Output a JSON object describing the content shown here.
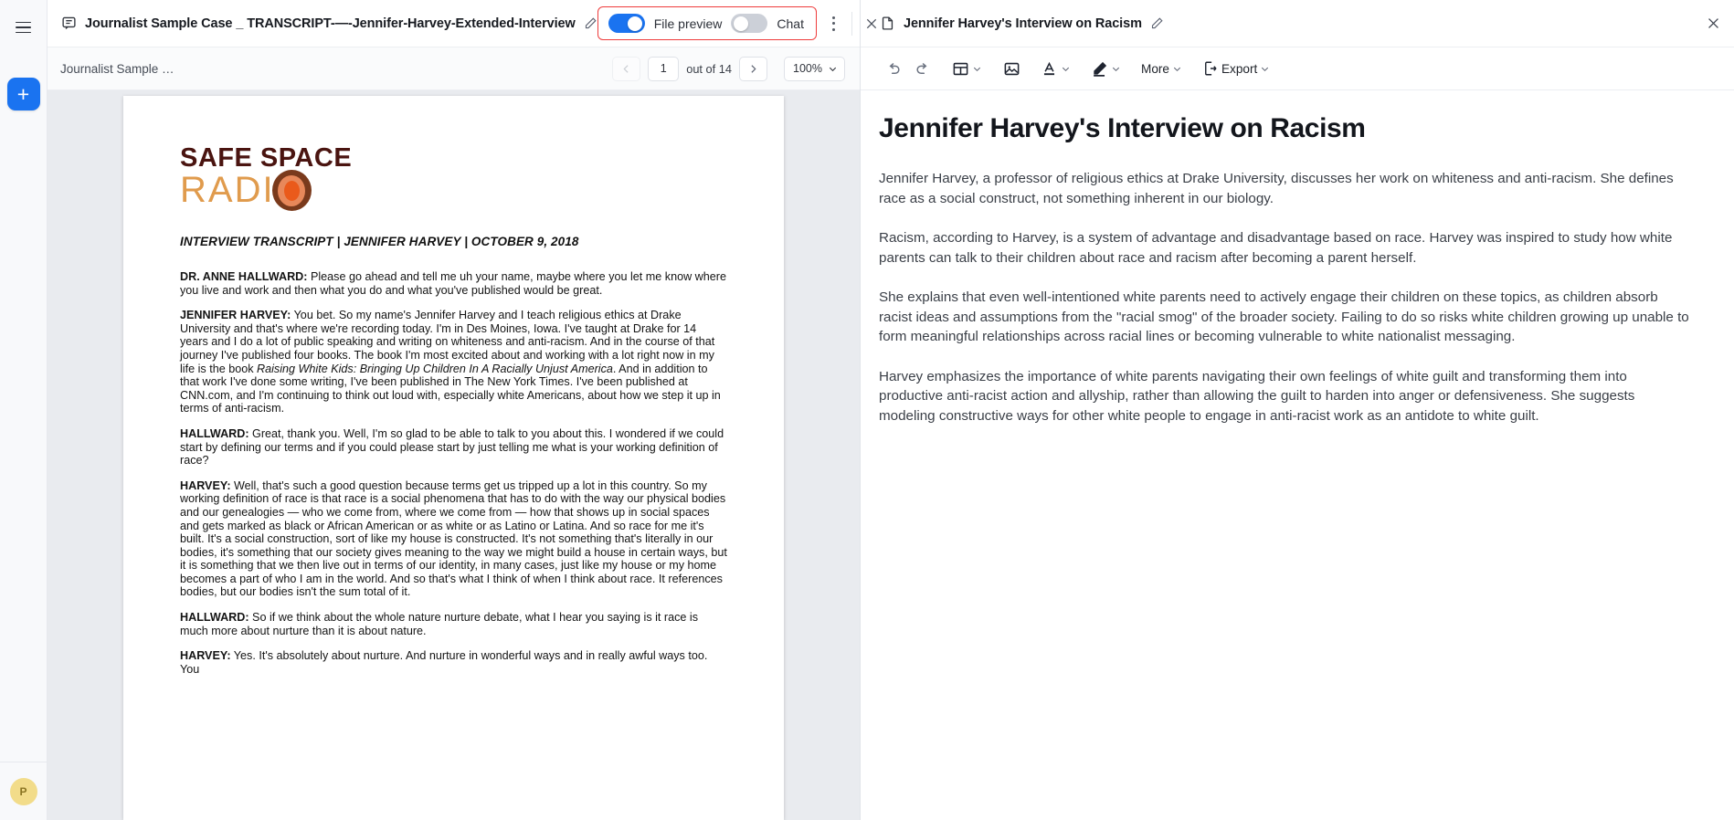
{
  "rail": {
    "menu_icon": "hamburger-icon",
    "add_label": "+",
    "avatar_initial": "P"
  },
  "center_header": {
    "doc_icon": "transcript-file-icon",
    "title": "Journalist Sample Case _ TRANSCRIPT-—-Jennifer-Harvey-Extended-Interview",
    "edit_icon": "pencil-icon",
    "toggles": {
      "file_preview_label": "File preview",
      "file_preview_on": true,
      "chat_label": "Chat",
      "chat_on": false,
      "highlight_color": "#ee3c3c"
    },
    "more_icon": "kebab-menu-icon",
    "close_icon": "close-icon"
  },
  "preview_toolbar": {
    "breadcrumb": "Journalist Sample …",
    "prev_icon": "chevron-left-icon",
    "page_value": "1",
    "page_total_label": "out of 14",
    "next_icon": "chevron-right-icon",
    "zoom_value": "100%",
    "zoom_caret_icon": "chevron-down-icon"
  },
  "document": {
    "logo": {
      "line1": "SAFE SPACE",
      "line2": "RADI",
      "mark": "radio-dot-mark"
    },
    "heading": "INTERVIEW TRANSCRIPT | JENNIFER HARVEY | OCTOBER 9, 2018",
    "paragraphs": [
      {
        "speaker": "DR. ANNE HALLWARD:",
        "text": " Please go ahead and tell me uh your name, maybe where you let me know where you live and work and then what you do and what you've published would be great."
      },
      {
        "speaker": "JENNIFER HARVEY:",
        "text": " You bet. So my name's Jennifer Harvey and I teach religious ethics at Drake University and that's where we're recording today. I'm in Des Moines, Iowa. I've taught at Drake for 14 years and I do a lot of public speaking and writing on whiteness and anti-racism. And in the course of that journey I've published four books. The book I'm most excited about and working with a lot right now in my life is the book ",
        "italic": "Raising White Kids: Bringing Up Children In A Racially Unjust America",
        "text2": ". And in addition to that work I've done some writing, I've been published in The New York Times. I've been published at CNN.com, and I'm continuing to think out loud with, especially white Americans, about how we step it up in terms of anti-racism."
      },
      {
        "speaker": "HALLWARD:",
        "text": " Great, thank you. Well, I'm so glad to be able to talk to you about this. I wondered if we could start by defining our terms and if you could please start by just telling me what is your working definition of race?"
      },
      {
        "speaker": "HARVEY:",
        "text": " Well, that's such a good question because terms get us tripped up a lot in this country. So my working definition of race is that race is a social phenomena that has to do with the way our physical bodies and our genealogies — who we come from, where we come from — how that shows up in social spaces and gets marked as black or African American or as white or as Latino or Latina. And so race for me it's built. It's a social construction, sort of like my house is constructed. It's not something that's literally in our bodies, it's something that our society gives meaning to the way we might build a house in certain ways, but it is something that we then live out in terms of our identity, in many cases, just like my house or my home becomes a part of who I am in the world. And so that's what I think of when I think about race. It references bodies, but our bodies isn't the sum total of it."
      },
      {
        "speaker": "HALLWARD:",
        "text": " So if we think about the whole nature nurture debate, what I hear you saying is it race is much more about nurture than it is about nature."
      },
      {
        "speaker": "HARVEY:",
        "text": " Yes. It's absolutely about nurture. And nurture in wonderful ways and in really awful ways too. You"
      }
    ]
  },
  "right_header": {
    "doc_icon": "document-icon",
    "title": "Jennifer Harvey's Interview on Racism",
    "edit_icon": "pencil-icon",
    "close_icon": "close-icon"
  },
  "editor_toolbar": {
    "items": [
      {
        "name": "undo-icon",
        "label": "",
        "caret": false
      },
      {
        "name": "redo-icon",
        "label": "",
        "caret": false
      },
      {
        "name": "table-icon",
        "label": "",
        "caret": true
      },
      {
        "name": "image-icon",
        "label": "",
        "caret": false
      },
      {
        "name": "text-color-icon",
        "label": "",
        "caret": true
      },
      {
        "name": "highlight-pen-icon",
        "label": "",
        "caret": true
      },
      {
        "name": "more-menu",
        "label": "More",
        "caret": true
      },
      {
        "name": "export-icon",
        "label": "Export",
        "caret": true
      }
    ]
  },
  "editor_doc": {
    "title": "Jennifer Harvey's Interview on Racism",
    "paragraphs": [
      "Jennifer Harvey, a professor of religious ethics at Drake University, discusses her work on whiteness and anti-racism. She defines race as a social construct, not something inherent in our biology.",
      "Racism, according to Harvey, is a system of advantage and disadvantage based on race. Harvey was inspired to study how white parents can talk to their children about race and racism after becoming a parent herself.",
      "She explains that even well-intentioned white parents need to actively engage their children on these topics, as children absorb racist ideas and assumptions from the \"racial smog\" of the broader society. Failing to do so risks white children growing up unable to form meaningful relationships across racial lines or becoming vulnerable to white nationalist messaging.",
      "Harvey emphasizes the importance of white parents navigating their own feelings of white guilt and transforming them into productive anti-racist action and allyship, rather than allowing the guilt to harden into anger or defensiveness. She suggests modeling constructive ways for other white people to engage in anti-racist work as an antidote to white guilt."
    ]
  }
}
